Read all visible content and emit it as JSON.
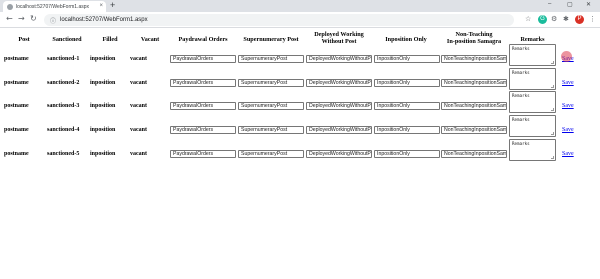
{
  "browser": {
    "tab_title": "localhost:52707/WebForm1.aspx",
    "tab_close": "×",
    "new_tab": "+",
    "url": "localhost:52707/WebForm1.aspx",
    "profile_initial": "P",
    "ext_initial": "G",
    "minimize": "–",
    "maximize": "▢",
    "close": "✕"
  },
  "table": {
    "headers": {
      "post": "Post",
      "sanctioned": "Sanctioned",
      "filled": "Filled",
      "vacant": "Vacant",
      "paydrawal": "Paydrawal Orders",
      "supernumerary": "Supernumerary Post",
      "deployed_line1": "Deployed Working",
      "deployed_line2": "Without Post",
      "inposition": "Inposition Only",
      "nonteaching_line1": "Non-Teaching",
      "nonteaching_line2": "In-position Samagra",
      "remarks": "Remarks"
    },
    "rows": [
      {
        "post": "postname",
        "sanctioned": "sanctioned-1",
        "filled": "inposition",
        "vacant": "vacant",
        "paydrawal": "PaydrawalOrders",
        "supernumerary": "SupernumeraryPost",
        "deployed": "DeployedWorkingWithoutPost",
        "inposition": "InpositionOnly",
        "nonteaching": "NonTeachingInpositionSamagra",
        "remarks": "Remarks",
        "save": "Save"
      },
      {
        "post": "postname",
        "sanctioned": "sanctioned-2",
        "filled": "inposition",
        "vacant": "vacant",
        "paydrawal": "PaydrawalOrders",
        "supernumerary": "SupernumeraryPost",
        "deployed": "DeployedWorkingWithoutPost",
        "inposition": "InpositionOnly",
        "nonteaching": "NonTeachingInpositionSamagra",
        "remarks": "Remarks",
        "save": "Save"
      },
      {
        "post": "postname",
        "sanctioned": "sanctioned-3",
        "filled": "inposition",
        "vacant": "vacant",
        "paydrawal": "PaydrawalOrders",
        "supernumerary": "SupernumeraryPost",
        "deployed": "DeployedWorkingWithoutPost",
        "inposition": "InpositionOnly",
        "nonteaching": "NonTeachingInpositionSamagra",
        "remarks": "Remarks",
        "save": "Save"
      },
      {
        "post": "postname",
        "sanctioned": "sanctioned-4",
        "filled": "inposition",
        "vacant": "vacant",
        "paydrawal": "PaydrawalOrders",
        "supernumerary": "SupernumeraryPost",
        "deployed": "DeployedWorkingWithoutPost",
        "inposition": "InpositionOnly",
        "nonteaching": "NonTeachingInpositionSamagra",
        "remarks": "Remarks",
        "save": "Save"
      },
      {
        "post": "postname",
        "sanctioned": "sanctioned-5",
        "filled": "inposition",
        "vacant": "vacant",
        "paydrawal": "PaydrawalOrders",
        "supernumerary": "SupernumeraryPost",
        "deployed": "DeployedWorkingWithoutPost",
        "inposition": "InpositionOnly",
        "nonteaching": "NonTeachingInpositionSamagra",
        "remarks": "Remarks",
        "save": "Save"
      }
    ]
  },
  "colors": {
    "link": "#0000ee",
    "profile": "#d93025",
    "extension": "#1abc9c"
  }
}
